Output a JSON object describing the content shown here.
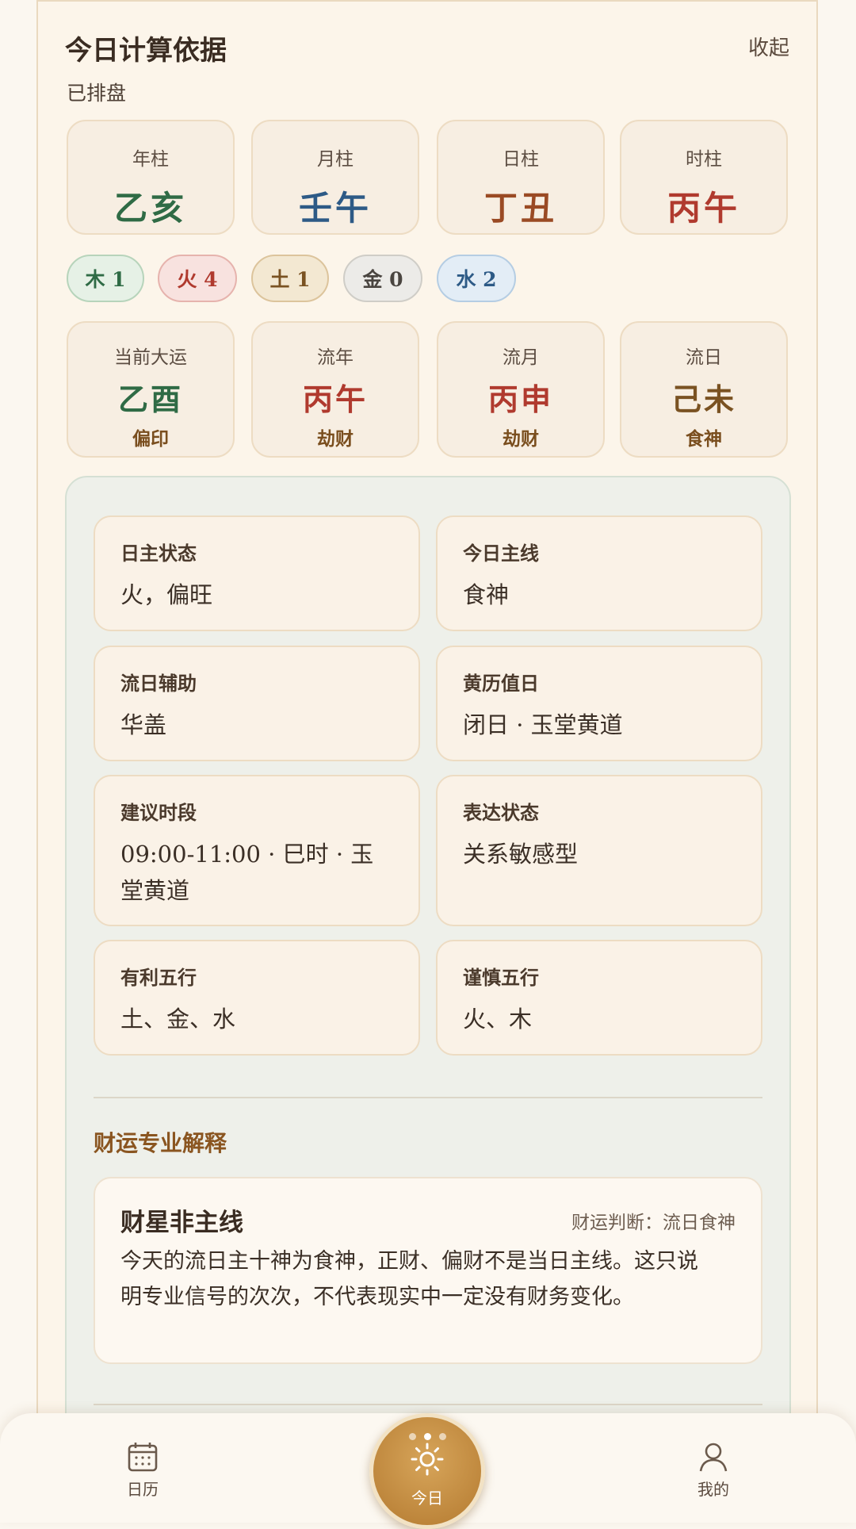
{
  "header": {
    "title": "今日计算依据",
    "collapse": "收起",
    "subtitle": "已排盘"
  },
  "pillars": [
    {
      "label": "年柱",
      "value": "乙亥",
      "color": "#2f6b45"
    },
    {
      "label": "月柱",
      "value": "壬午",
      "color": "#2d5a86"
    },
    {
      "label": "日柱",
      "value": "丁丑",
      "color": "#9a4a24"
    },
    {
      "label": "时柱",
      "value": "丙午",
      "color": "#b03a2e"
    }
  ],
  "elements": [
    {
      "label": "木 1",
      "bg": "#e6f1e6",
      "border": "#b7d4bb",
      "color": "#2f6b45"
    },
    {
      "label": "火 4",
      "bg": "#f8e2df",
      "border": "#e6b3ad",
      "color": "#b03a2e"
    },
    {
      "label": "土 1",
      "bg": "#f3e8d2",
      "border": "#dcc49c",
      "color": "#7a5222"
    },
    {
      "label": "金 0",
      "bg": "#ecebe8",
      "border": "#cfcdc7",
      "color": "#4a4540"
    },
    {
      "label": "水 2",
      "bg": "#e3edf6",
      "border": "#b5cde3",
      "color": "#2d5a86"
    }
  ],
  "luck": [
    {
      "label": "当前大运",
      "value": "乙酉",
      "god": "偏印",
      "color": "#2f6b45"
    },
    {
      "label": "流年",
      "value": "丙午",
      "god": "劫财",
      "color": "#b03a2e"
    },
    {
      "label": "流月",
      "value": "丙申",
      "god": "劫财",
      "color": "#b03a2e"
    },
    {
      "label": "流日",
      "value": "己未",
      "god": "食神",
      "color": "#7a5222"
    }
  ],
  "info": {
    "day_master": {
      "title": "日主状态",
      "value": "火，偏旺"
    },
    "main_line": {
      "title": "今日主线",
      "value": "食神"
    },
    "day_aid": {
      "title": "流日辅助",
      "value": "华盖"
    },
    "almanac": {
      "title": "黄历值日",
      "value": "闭日 · 玉堂黄道"
    },
    "time_slot": {
      "title": "建议时段",
      "value": "09:00-11:00 · 巳时 · 玉堂黄道"
    },
    "expression": {
      "title": "表达状态",
      "value": "关系敏感型"
    },
    "favorable": {
      "title": "有利五行",
      "value": "土、金、水"
    },
    "caution": {
      "title": "谨慎五行",
      "value": "火、木"
    }
  },
  "wealth": {
    "section_title": "财运专业解释",
    "card_title": "财星非主线",
    "judgement": "财运判断：流日食神",
    "body": "今天的流日主十神为食神，正财、偏财不是当日主线。这只说明专业信号的次次，不代表现实中一定没有财务变化。"
  },
  "nav": {
    "calendar": "日历",
    "today": "今日",
    "mine": "我的"
  }
}
